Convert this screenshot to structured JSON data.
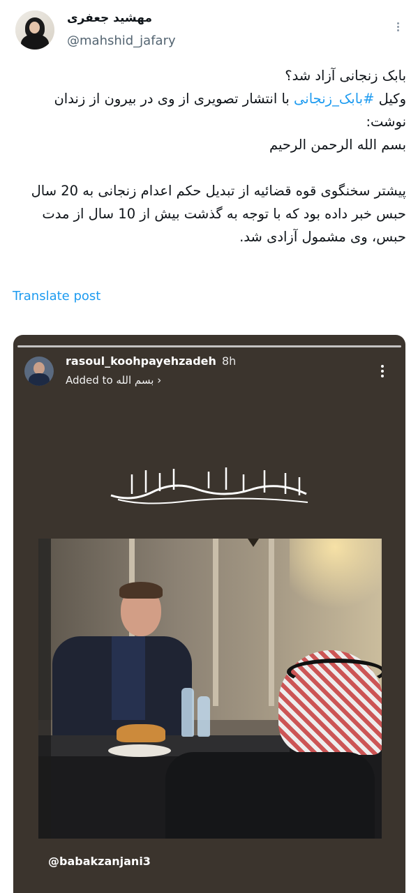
{
  "author": {
    "display_name": "مهشید جعفری",
    "handle": "@mahshid_jafary"
  },
  "tweet": {
    "line1": "بابک زنجانی آزاد شد؟",
    "line2_prefix": "وکیل ",
    "hashtag": "#بابک_زنجانی",
    "line2_suffix": " با انتشار تصویری از وی  در بیرون از زندان نوشت:",
    "line3": "بسم الله الرحمن الرحیم",
    "line4": "پیشتر سخنگوی قوه قضائیه  از تبدیل حکم اعدام زنجانی به 20 سال حبس خبر داده بود که با توجه به گذشت بیش از 10 سال از مدت حبس، وی مشمول آزادی شد."
  },
  "translate_label": "Translate post",
  "story": {
    "username": "rasoul_koohpayehzadeh",
    "time": "8h",
    "added_prefix": "Added to",
    "album": "بسم الله",
    "chevron": "›",
    "watermark": "@babakzanjani3"
  },
  "icons": {
    "more": "more-vertical-icon",
    "chevron": "chevron-right-icon"
  },
  "colors": {
    "link": "#1d9bf0",
    "story_bg": "#3b342d",
    "secondary_text": "#536471"
  }
}
